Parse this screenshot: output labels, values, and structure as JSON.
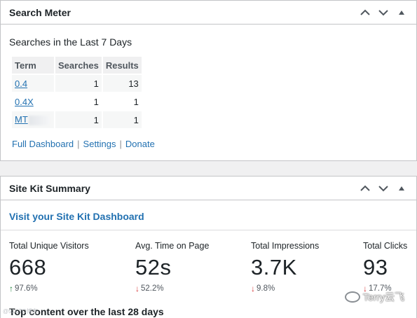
{
  "search_meter": {
    "title": "Search Meter",
    "heading": "Searches in the Last 7 Days",
    "columns": [
      "Term",
      "Searches",
      "Results"
    ],
    "rows": [
      {
        "term": "0.4",
        "searches": "1",
        "results": "13"
      },
      {
        "term": "0.4X",
        "searches": "1",
        "results": "1"
      },
      {
        "term": "MT",
        "searches": "1",
        "results": "1"
      }
    ],
    "links": [
      "Full Dashboard",
      "Settings",
      "Donate"
    ],
    "separator": "|"
  },
  "site_kit": {
    "title": "Site Kit Summary",
    "dashboard_link": "Visit your Site Kit Dashboard",
    "stats": [
      {
        "label": "Total Unique Visitors",
        "value": "668",
        "change": "97.6%",
        "direction": "up"
      },
      {
        "label": "Avg. Time on Page",
        "value": "52s",
        "change": "52.2%",
        "direction": "down"
      },
      {
        "label": "Total Impressions",
        "value": "3.7K",
        "change": "9.8%",
        "direction": "down"
      },
      {
        "label": "Total Clicks",
        "value": "93",
        "change": "17.7%",
        "direction": "down"
      }
    ],
    "top_content": "Top content over the last 28 days"
  },
  "icons": {
    "move_up": "chevron-up-icon",
    "move_down": "chevron-down-icon",
    "toggle": "triangle-up-icon",
    "trend_up": "arrow-up-icon",
    "trend_down": "arrow-down-icon"
  },
  "colors": {
    "link": "#2271b1",
    "up": "#1a7f37",
    "down": "#d63638",
    "border": "#c3c4c7",
    "background": "#f0f0f1"
  },
  "watermark": {
    "left": "@51CTO博客",
    "right": "Terry云飞"
  },
  "arrows": {
    "up": "↑",
    "down": "↓"
  }
}
